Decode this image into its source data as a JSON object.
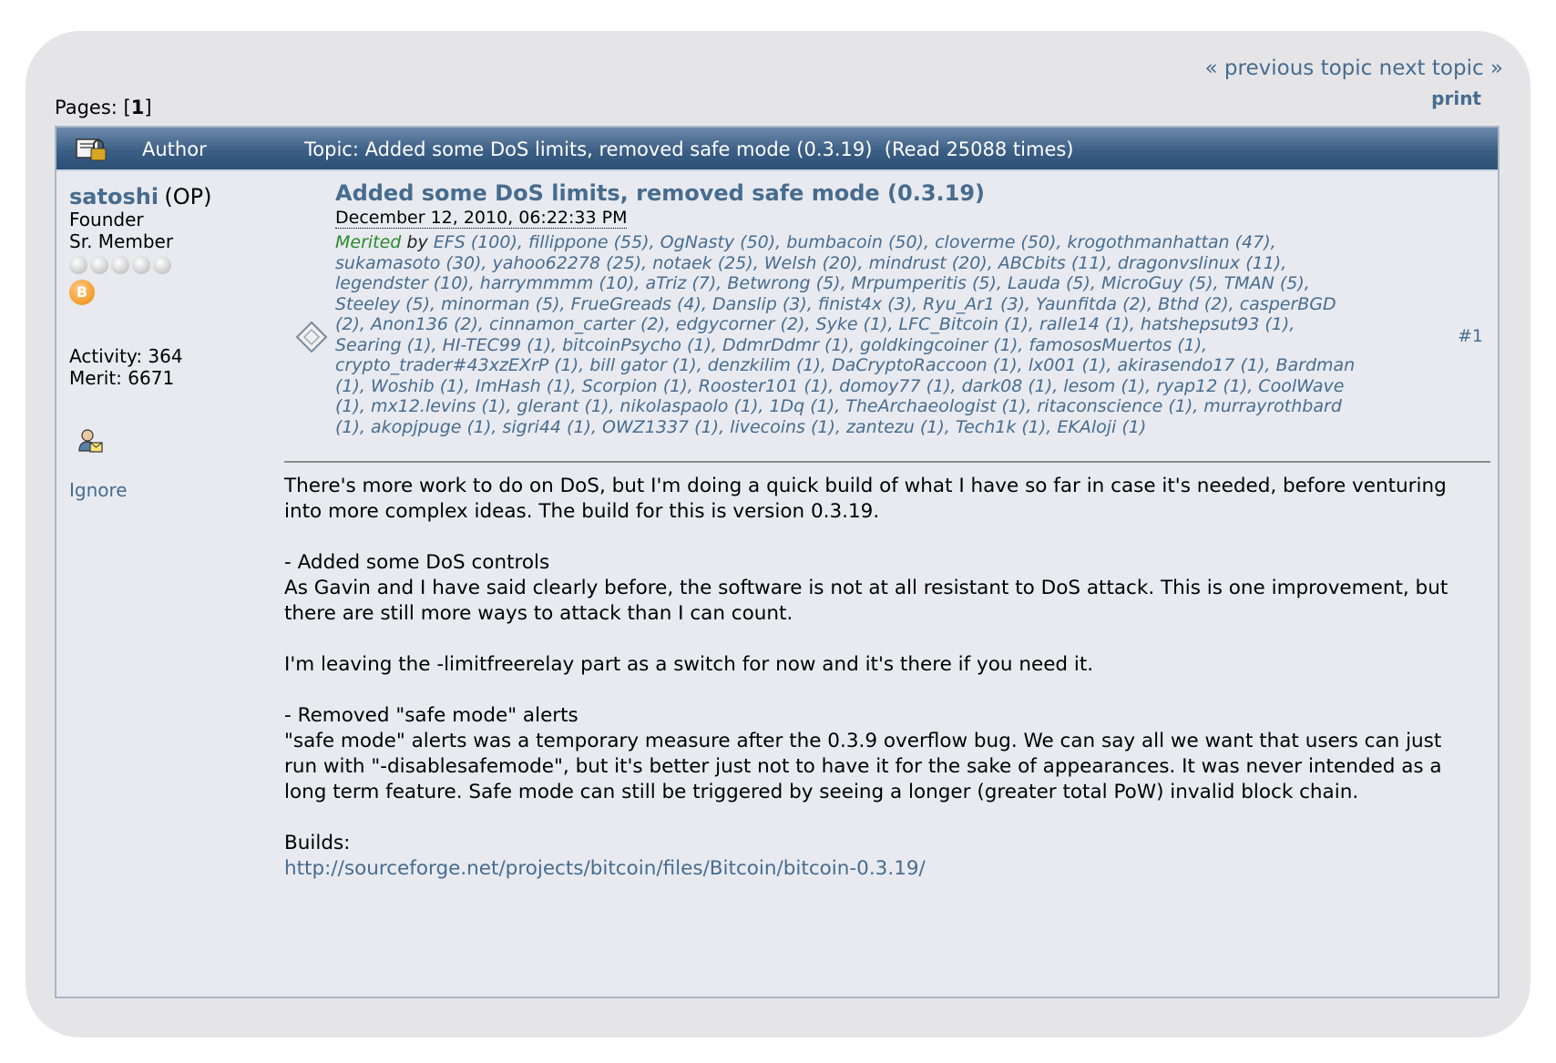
{
  "nav": {
    "prev": "« previous topic",
    "next": "next topic »",
    "print": "print"
  },
  "pages": {
    "label": "Pages: [",
    "current": "1",
    "close": "]"
  },
  "header": {
    "author_col": "Author",
    "topic_label": "Topic: Added some DoS limits, removed safe mode (0.3.19)  (Read 25088 times)"
  },
  "poster": {
    "name": "satoshi",
    "op": "(OP)",
    "title": "Founder",
    "rank": "Sr. Member",
    "activity": "Activity: 364",
    "merit": "Merit: 6671",
    "ignore": "Ignore",
    "coin_glyph": "B"
  },
  "post": {
    "subject": "Added some DoS limits, removed safe mode (0.3.19)",
    "date": "December 12, 2010, 06:22:33 PM",
    "merited_label": "Merited",
    "by_label": " by ",
    "merit_list": "EFS (100), fillippone (55), OgNasty (50), bumbacoin (50), cloverme (50), krogothmanhattan (47), sukamasoto (30), yahoo62278 (25), notaek (25), Welsh (20), mindrust (20), ABCbits (11), dragonvslinux (11), legendster (10), harrymmmm (10), aTriz (7), Betwrong (5), Mrpumperitis (5), Lauda (5), MicroGuy (5), TMAN (5), Steeley (5), minorman (5), FrueGreads (4), Danslip (3), finist4x (3), Ryu_Ar1 (3), Yaunfitda (2), Bthd (2), casperBGD (2), Anon136 (2), cinnamon_carter (2), edgycorner (2), Syke (1), LFC_Bitcoin (1), ralle14 (1), hatshepsut93 (1), Searing (1), HI-TEC99 (1), bitcoinPsycho (1), DdmrDdmr (1), goldkingcoiner (1), famososMuertos (1), crypto_trader#43xzEXrP (1), bill gator (1), denzkilim (1), DaCryptoRaccoon (1), lx001 (1), akirasendo17 (1), Bardman (1), Woshib (1), ImHash (1), Scorpion (1), Rooster101 (1), domoy77 (1), dark08 (1), lesom (1), ryap12 (1), CoolWave (1), mx12.levins (1), glerant (1), nikolaspaolo (1), 1Dq (1), TheArchaeologist (1), ritaconscience (1), murrayrothbard (1), akopjpuge (1), sigri44 (1), OWZ1337 (1), livecoins (1), zantezu (1), Tech1k (1), EKAloji (1)",
    "number": "#1",
    "body": {
      "p1": "There's more work to do on DoS, but I'm doing a quick build of what I have so far in case it's needed, before venturing into more complex ideas.  The build for this is version 0.3.19.",
      "p2a": "- Added some DoS controls",
      "p2b": "As Gavin and I have said clearly before, the software is not at all resistant to DoS attack.  This is one improvement, but there are still more ways to attack than I can count.",
      "p3": "I'm leaving the -limitfreerelay part as a switch for now and it's there if you need it.",
      "p4a": "- Removed \"safe mode\" alerts",
      "p4b": "\"safe mode\" alerts was a temporary measure after the 0.3.9 overflow bug.  We can say all we want that users can just run with \"-disablesafemode\", but it's better just not to have it for the sake of appearances.  It was never intended as a long term feature.  Safe mode can still be triggered by seeing a longer (greater total PoW) invalid block chain.",
      "p5a": "Builds:",
      "link": "http://sourceforge.net/projects/bitcoin/files/Bitcoin/bitcoin-0.3.19/"
    }
  },
  "colors": {
    "link": "#476c8e",
    "merited": "#2a8a2a",
    "titlebar": "#3c5f86"
  },
  "icons": [
    "topic-locked-icon",
    "star-icon",
    "bitcoin-badge-icon",
    "personal-message-icon",
    "post-icon"
  ]
}
